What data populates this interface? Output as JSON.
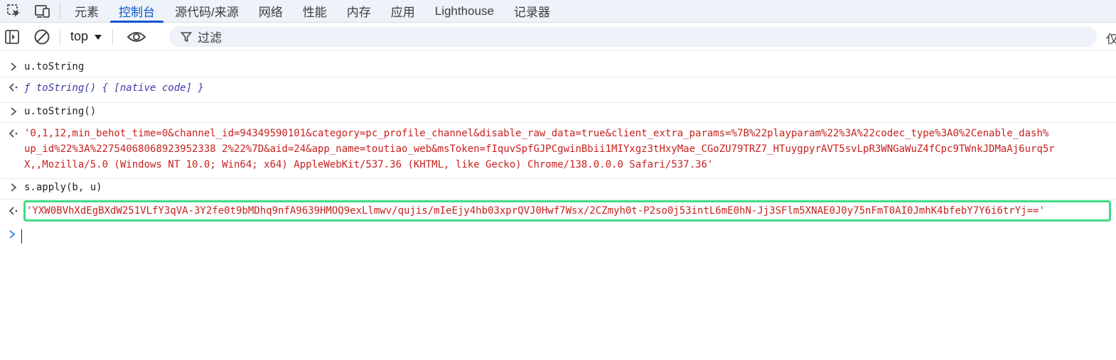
{
  "tabs": [
    {
      "label": "元素",
      "active": false
    },
    {
      "label": "控制台",
      "active": true
    },
    {
      "label": "源代码/来源",
      "active": false
    },
    {
      "label": "网络",
      "active": false
    },
    {
      "label": "性能",
      "active": false
    },
    {
      "label": "内存",
      "active": false
    },
    {
      "label": "应用",
      "active": false
    },
    {
      "label": "Lighthouse",
      "active": false
    },
    {
      "label": "记录器",
      "active": false
    }
  ],
  "toolbar": {
    "context": "top",
    "filter_placeholder": "过滤",
    "overflow_text": "仅"
  },
  "console": {
    "lines": [
      {
        "type": "input",
        "text": "u.toString"
      },
      {
        "type": "output",
        "text": "ƒ toString() { [native code] }"
      },
      {
        "type": "input",
        "text": "u.toString()"
      },
      {
        "type": "output",
        "line1": "'0,1,12,min_behot_time=0&channel_id=94349590101&category=pc_profile_channel&disable_raw_data=true&client_extra_params=%7B%22playparam%22%3A%22codec_type%3A0%2Cenable_dash%",
        "line2": "up_id%22%3A%22754068068923952338 2%22%7D&aid=24&app_name=toutiao_web&msToken=fIquvSpfGJPCgwinBbii1MIYxgz3tHxyMae_CGoZU79TRZ7_HTuygpyrAVT5svLpR3WNGaWuZ4fCpc9TWnkJDMaAj6urq5r",
        "line3": "X,,Mozilla/5.0 (Windows NT 10.0; Win64; x64) AppleWebKit/537.36 (KHTML, like Gecko) Chrome/138.0.0.0 Safari/537.36'"
      },
      {
        "type": "input",
        "text": "s.apply(b, u)"
      },
      {
        "type": "output",
        "text": "'YXW0BVhXdEgBXdW251VLfY3qVA-3Y2fe0t9bMDhq9nfA9639HMOQ9exLlmwv/qujis/mIeEjy4hb03xprQVJ0Hwf7Wsx/2CZmyh0t-P2so0j53intL6mE0hN-Jj3SFlm5XNAE0J0y75nFmT0AI0JmhK4bfebY7Y6i6trYj=='"
      }
    ]
  },
  "colors": {
    "accent": "#0b57d0",
    "string": "#c5221f",
    "highlight_border": "#3ddc84"
  }
}
